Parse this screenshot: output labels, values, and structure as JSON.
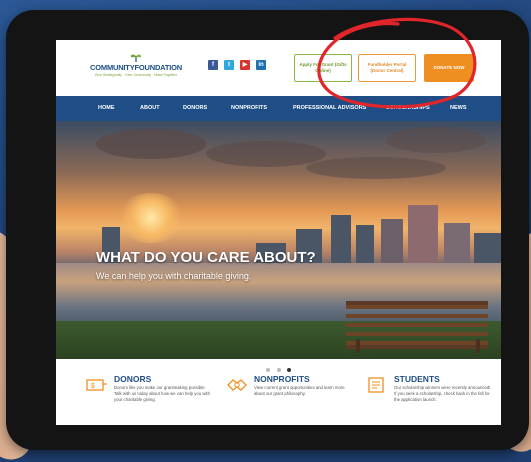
{
  "site": {
    "logo_name": "COMMUNITYFOUNDATION",
    "logo_tagline": "Give Strategically · Give Generously · Make Together"
  },
  "social": [
    {
      "icon": "facebook-icon",
      "glyph": "f",
      "color": "#3b5998"
    },
    {
      "icon": "twitter-icon",
      "glyph": "t",
      "color": "#2fa7e0"
    },
    {
      "icon": "youtube-icon",
      "glyph": "▶",
      "color": "#d9342b"
    },
    {
      "icon": "linkedin-icon",
      "glyph": "in",
      "color": "#1f6fb0"
    }
  ],
  "header_buttons": {
    "apply": "Apply For Grant (Gifts Online)",
    "fundholder": "Fundholder Portal (Donor Central)",
    "donate": "DONATE NOW"
  },
  "nav": [
    "HOME",
    "ABOUT",
    "DONORS",
    "NONPROFITS",
    "PROFESSIONAL ADVISORS",
    "SCHOLARSHIPS",
    "NEWS"
  ],
  "hero": {
    "title": "WHAT DO YOU CARE ABOUT?",
    "subtitle": "We can help you with charitable giving."
  },
  "carousel": {
    "count": 3,
    "active": 2
  },
  "features": [
    {
      "title": "DONORS",
      "text": "Donors like you make our grantmaking possible. Talk with us today about how we can help you with your charitable giving."
    },
    {
      "title": "NONPROFITS",
      "text": "View current grant opportunities and learn more about our grant philosophy."
    },
    {
      "title": "STUDENTS",
      "text": "Our scholarship winners were recently announced! If you seek a scholarship, check back in the fall for the application launch."
    }
  ],
  "colors": {
    "brand_blue": "#1f4e86",
    "accent_orange": "#ef8f22",
    "accent_green": "#8bb843",
    "annotation_red": "#e0262b"
  }
}
